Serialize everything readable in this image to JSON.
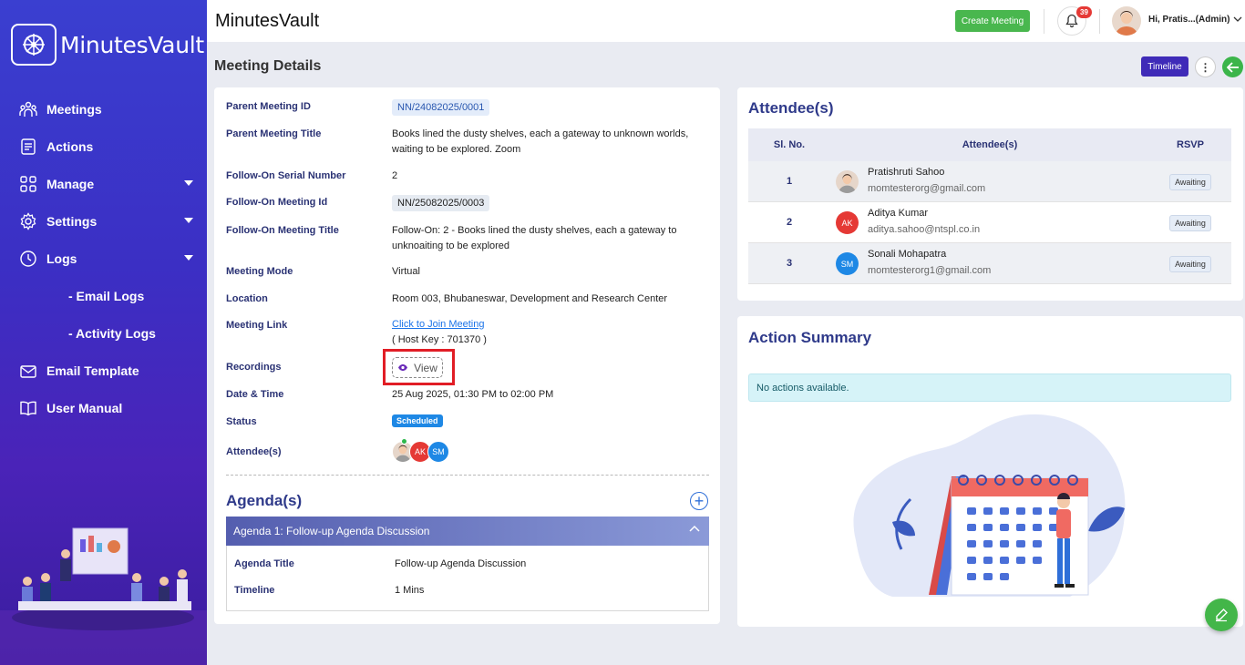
{
  "brand": {
    "name": "MinutesVault"
  },
  "sidebar": {
    "items": [
      {
        "label": "Meetings",
        "icon": "meetings-icon",
        "caret": false
      },
      {
        "label": "Actions",
        "icon": "actions-icon",
        "caret": false
      },
      {
        "label": "Manage",
        "icon": "manage-icon",
        "caret": true
      },
      {
        "label": "Settings",
        "icon": "gear-icon",
        "caret": true
      },
      {
        "label": "Logs",
        "icon": "clock-icon",
        "caret": true
      },
      {
        "label": "- Email Logs",
        "icon": null,
        "caret": false
      },
      {
        "label": "- Activity Logs",
        "icon": null,
        "caret": false
      },
      {
        "label": "Email Template",
        "icon": "mail-icon",
        "caret": false
      },
      {
        "label": "User Manual",
        "icon": "book-icon",
        "caret": false
      }
    ]
  },
  "topbar": {
    "title": "MinutesVault",
    "create_label": "Create Meeting",
    "notifications": "39",
    "user_greeting": "Hi, Pratis...(Admin)"
  },
  "page": {
    "title": "Meeting Details",
    "timeline_label": "Timeline"
  },
  "details": {
    "parent_id_label": "Parent Meeting ID",
    "parent_id": "NN/24082025/0001",
    "parent_title_label": "Parent Meeting Title",
    "parent_title": "Books lined the dusty shelves, each a gateway to unknown worlds, waiting to be explored. Zoom",
    "serial_label": "Follow-On Serial Number",
    "serial": "2",
    "fo_id_label": "Follow-On Meeting Id",
    "fo_id": "NN/25082025/0003",
    "fo_title_label": "Follow-On Meeting Title",
    "fo_title": "Follow-On: 2 - Books lined the dusty shelves, each a gateway to unknoaiting to be explored",
    "mode_label": "Meeting Mode",
    "mode": "Virtual",
    "location_label": "Location",
    "location": "Room 003, Bhubaneswar, Development and Research Center",
    "link_label": "Meeting Link",
    "link_text": "Click to Join Meeting",
    "host_key": "( Host Key : 701370 )",
    "recordings_label": "Recordings",
    "view_label": "View",
    "datetime_label": "Date & Time",
    "datetime": "25 Aug 2025, 01:30 PM to 02:00 PM",
    "status_label": "Status",
    "status": "Scheduled",
    "attendees_label": "Attendee(s)",
    "attendee_initials": [
      "",
      "AK",
      "SM"
    ]
  },
  "agenda": {
    "heading": "Agenda(s)",
    "items": [
      {
        "header": "Agenda 1: Follow-up Agenda Discussion",
        "title_label": "Agenda Title",
        "title": "Follow-up Agenda Discussion",
        "timeline_label": "Timeline",
        "timeline": "1 Mins"
      }
    ]
  },
  "attendees": {
    "heading": "Attendee(s)",
    "columns": [
      "Sl. No.",
      "Attendee(s)",
      "RSVP"
    ],
    "rows": [
      {
        "sl": "1",
        "name": "Pratishruti Sahoo",
        "email": "momtesterorg@gmail.com",
        "initials": "",
        "color": "#e6d6ca",
        "rsvp": "Awaiting"
      },
      {
        "sl": "2",
        "name": "Aditya Kumar",
        "email": "aditya.sahoo@ntspl.co.in",
        "initials": "AK",
        "color": "#e53935",
        "rsvp": "Awaiting"
      },
      {
        "sl": "3",
        "name": "Sonali Mohapatra",
        "email": "momtesterorg1@gmail.com",
        "initials": "SM",
        "color": "#1e88e5",
        "rsvp": "Awaiting"
      }
    ]
  },
  "actions": {
    "heading": "Action Summary",
    "empty": "No actions available."
  },
  "colors": {
    "accent": "#3f2bb8",
    "success": "#49b74e",
    "highlight": "#e11d25"
  }
}
